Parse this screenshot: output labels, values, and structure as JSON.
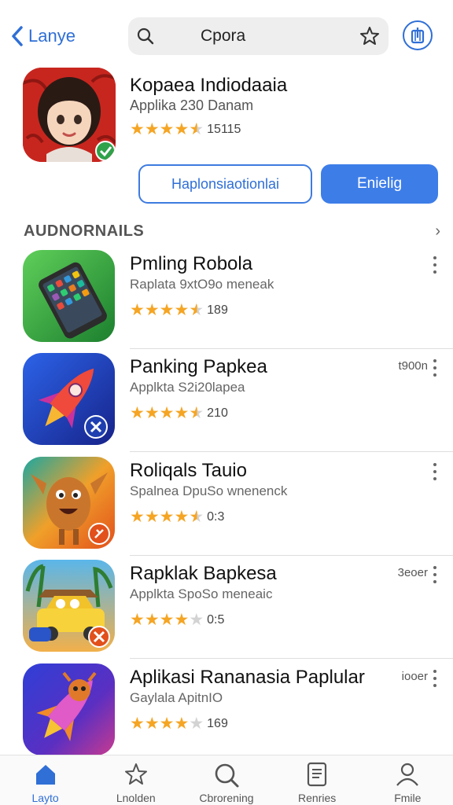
{
  "nav": {
    "back_label": "Lanye",
    "search_query": "Cpora"
  },
  "featured": {
    "title": "Kopaea Indiodaaia",
    "subtitle": "Applika 230 Danam",
    "rating": 4.5,
    "rating_count": "15115",
    "secondary_button": "Haplonsiaotionlai",
    "primary_button": "Enielig"
  },
  "section": {
    "title": "AUDNORNAILS"
  },
  "apps": [
    {
      "name": "Pmling Robola",
      "subtitle": "Raplata 9xtO9o meneak",
      "rating": 4.5,
      "rating_count": "189",
      "size": "",
      "icon": "smartphone-icon",
      "theme": "#2e9e3f"
    },
    {
      "name": "Panking Papkea",
      "subtitle": "Applkta S2i20lapea",
      "rating": 4.5,
      "rating_count": "210",
      "size": "t900n",
      "icon": "rocket-icon",
      "theme": "#1f3fb0"
    },
    {
      "name": "Roliqals Tauio",
      "subtitle": "Spalnea DpuSo wnenenck",
      "rating": 4.5,
      "rating_count": "0:3",
      "size": "",
      "icon": "monster-icon",
      "theme": "#ef6f1d"
    },
    {
      "name": "Rapklak Bapkesa",
      "subtitle": "Applkta SpoSo meneaic",
      "rating": 4.5,
      "rating_count": "0:5",
      "size": "3eoer",
      "icon": "car-icon",
      "theme": "#3c8fd1"
    },
    {
      "name": "Aplikasi Rananasia Paplular",
      "subtitle": "Gaylala ApitnIO",
      "rating": 4.5,
      "rating_count": "169",
      "size": "iooer",
      "icon": "rocket-character-icon",
      "theme": "#3b39c2"
    }
  ],
  "tabs": [
    {
      "label": "Layto",
      "icon": "home-icon",
      "active": true
    },
    {
      "label": "Lnolden",
      "icon": "star-icon",
      "active": false
    },
    {
      "label": "Cbrorening",
      "icon": "search-icon",
      "active": false
    },
    {
      "label": "Renries",
      "icon": "document-icon",
      "active": false
    },
    {
      "label": "Fmile",
      "icon": "profile-icon",
      "active": false
    }
  ],
  "colors": {
    "accent": "#2f6fd6",
    "primary_button": "#3d7de8",
    "star": "#f5a524",
    "star_empty": "#d3d3d3"
  }
}
